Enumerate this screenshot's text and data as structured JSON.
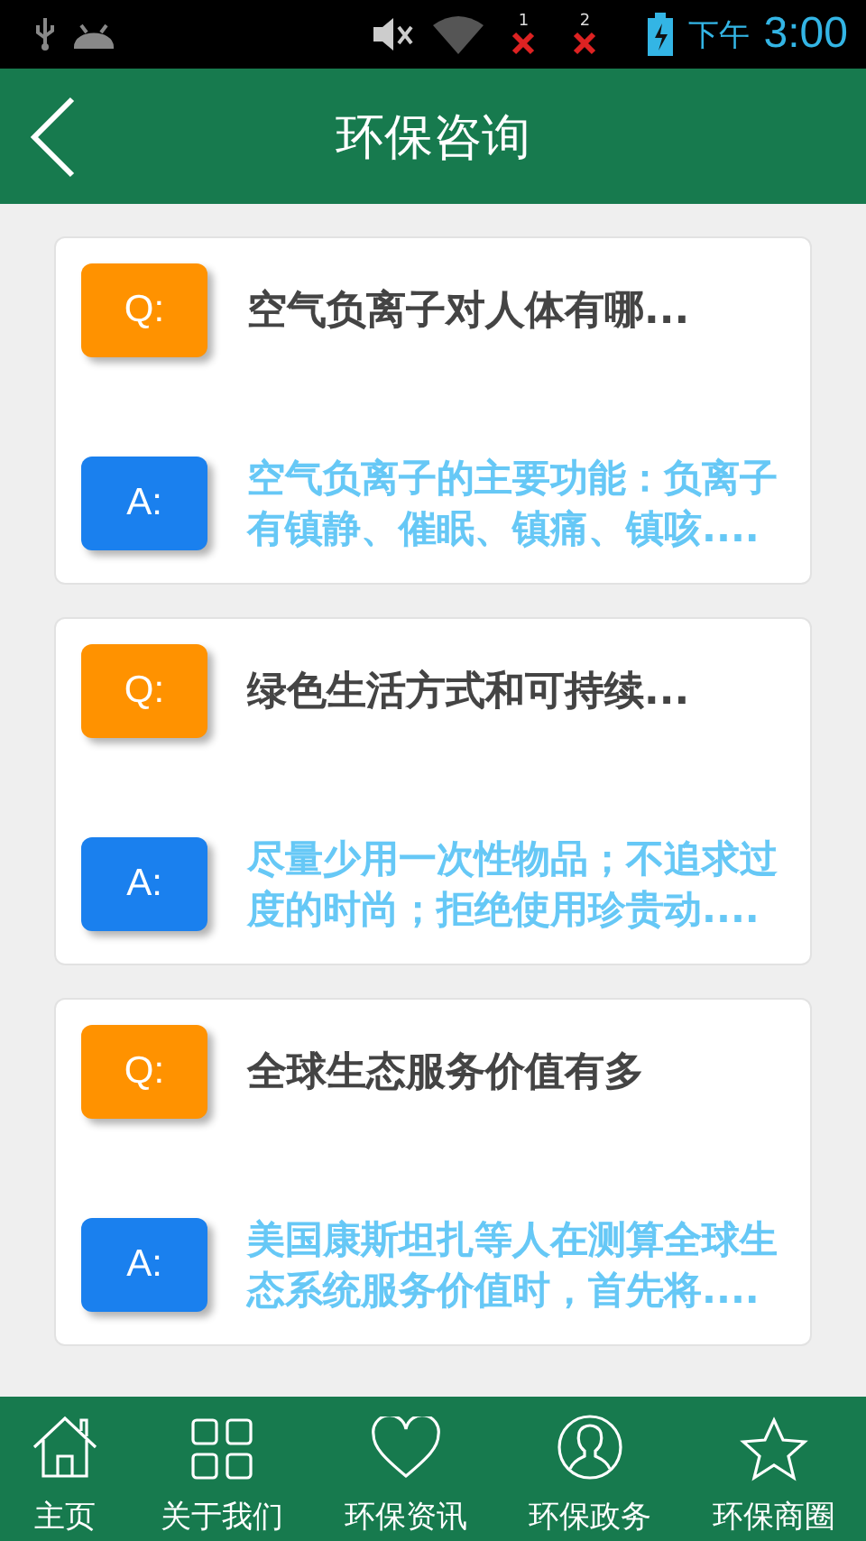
{
  "status_bar": {
    "sim_1": "1",
    "sim_2": "2",
    "period": "下午",
    "time": "3:00"
  },
  "header": {
    "title": "环保咨询"
  },
  "items": [
    {
      "q_label": "Q:",
      "question": "空气负离子对人体有哪...",
      "a_label": "A:",
      "answer": "空气负离子的主要功能：负离子有镇静、催眠、镇痛、镇咳...."
    },
    {
      "q_label": "Q:",
      "question": "绿色生活方式和可持续...",
      "a_label": "A:",
      "answer": "尽量少用一次性物品；不追求过度的时尚；拒绝使用珍贵动...."
    },
    {
      "q_label": "Q:",
      "question": "全球生态服务价值有多",
      "a_label": "A:",
      "answer": "美国康斯坦扎等人在测算全球生态系统服务价值时，首先将...."
    }
  ],
  "nav": [
    {
      "kind": "home",
      "label": "主页"
    },
    {
      "kind": "grid",
      "label": "关于我们"
    },
    {
      "kind": "heart",
      "label": "环保资讯"
    },
    {
      "kind": "person",
      "label": "环保政务"
    },
    {
      "kind": "star",
      "label": "环保商圈"
    }
  ]
}
